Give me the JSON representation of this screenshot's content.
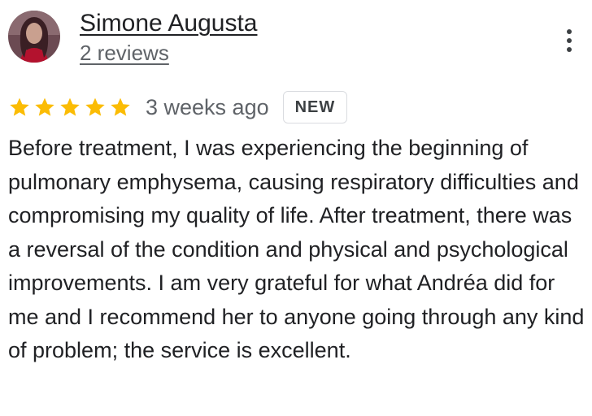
{
  "review": {
    "author": {
      "name": "Simone Augusta",
      "reviews_count": "2 reviews",
      "avatar": "user-avatar-photo"
    },
    "rating": 5,
    "rating_max": 5,
    "star_icon": "star-icon",
    "star_color": "#fbbc04",
    "time_ago": "3 weeks ago",
    "badge": "NEW",
    "menu_icon": "more-vert-icon",
    "text": "Before treatment, I was experiencing the beginning of pulmonary emphysema, causing respiratory difficulties and compromising my quality of life. After treatment, there was a reversal of the condition and physical and psychological improvements. I am very grateful for what Andréa did for me and I recommend her to anyone going through any kind of problem; the service is excellent."
  }
}
